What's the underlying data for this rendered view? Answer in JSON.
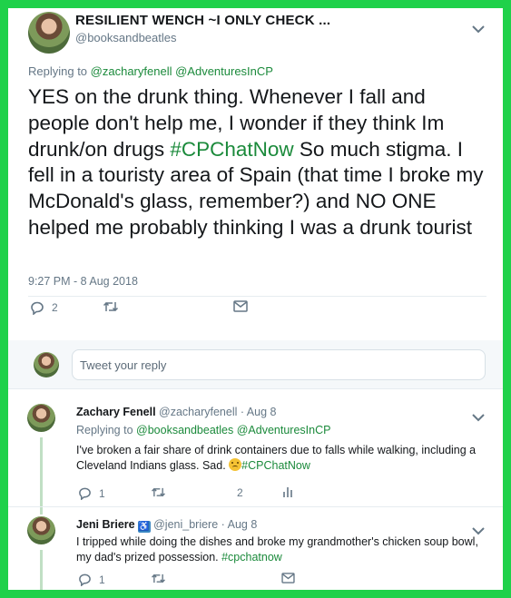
{
  "main_tweet": {
    "author_name": "RESILIENT WENCH ~I ONLY CHECK ...",
    "author_handle": "@booksandbeatles",
    "replying_to_label": "Replying to",
    "replying_to_1": "@zacharyfenell",
    "replying_to_2": "@AdventuresInCP",
    "text_before": "YES on the drunk thing. Whenever I fall and people don't help me, I wonder if they think Im drunk/on drugs ",
    "hashtag": "#CPChatNow",
    "text_after": " So much stigma. I fell in a touristy area of Spain (that time I broke my McDonald's glass, remember?) and NO ONE helped me probably thinking I was a drunk tourist",
    "timestamp": "9:27 PM - 8 Aug 2018",
    "reply_count": "2",
    "retweet_count": "",
    "like_count": ""
  },
  "composer": {
    "placeholder": "Tweet your reply"
  },
  "replies": [
    {
      "author_name": "Zachary Fenell",
      "author_handle": "@zacharyfenell",
      "date": "· Aug 8",
      "replying_to_label": "Replying to",
      "replying_to_1": "@booksandbeatles",
      "replying_to_2": "@AdventuresInCP",
      "text": "I've broken a fair share of drink containers due to falls while walking, including a Cleveland Indians glass. Sad. ",
      "hashtag": "#CPChatNow",
      "reply_count": "1",
      "like_count": "2"
    },
    {
      "author_name": "Jeni Briere",
      "author_handle": "@jeni_briere",
      "date": "· Aug 8",
      "wheelchair_glyph": "♿",
      "text": "I tripped while doing the dishes and broke my grandmother's chicken soup bowl, my dad's prized possession. ",
      "hashtag": "#cpchatnow",
      "reply_count": "1"
    }
  ],
  "colors": {
    "border_green": "#1fd14a",
    "link_green": "#1b8a3b",
    "muted": "#657786"
  }
}
